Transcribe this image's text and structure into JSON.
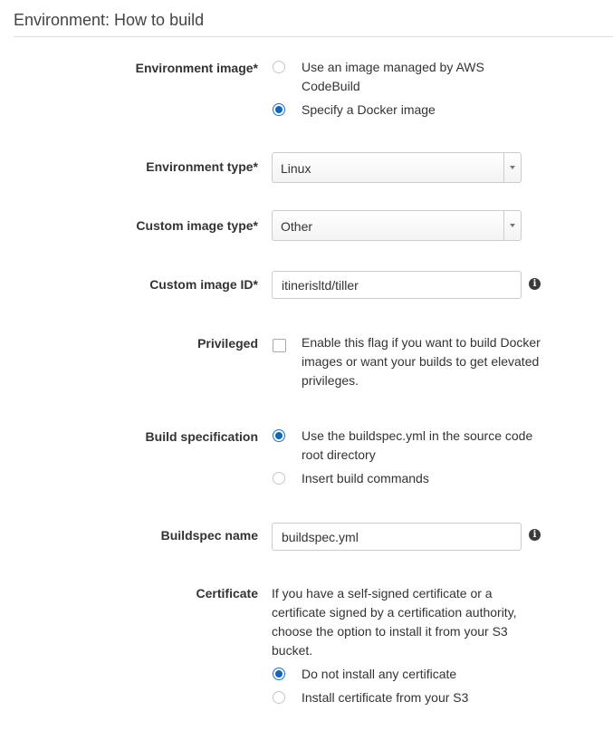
{
  "section": {
    "title": "Environment: How to build"
  },
  "env_image": {
    "label": "Environment image*",
    "options": [
      {
        "label": "Use an image managed by AWS CodeBuild",
        "selected": false
      },
      {
        "label": "Specify a Docker image",
        "selected": true
      }
    ]
  },
  "env_type": {
    "label": "Environment type*",
    "value": "Linux"
  },
  "custom_image_type": {
    "label": "Custom image type*",
    "value": "Other"
  },
  "custom_image_id": {
    "label": "Custom image ID*",
    "value": "itinerisltd/tiller",
    "info_icon": "info-icon"
  },
  "privileged": {
    "label": "Privileged",
    "checked": false,
    "text": "Enable this flag if you want to build Docker images or want your builds to get elevated privileges."
  },
  "build_spec": {
    "label": "Build specification",
    "options": [
      {
        "label": "Use the buildspec.yml in the source code root directory",
        "selected": true
      },
      {
        "label": "Insert build commands",
        "selected": false
      }
    ]
  },
  "buildspec_name": {
    "label": "Buildspec name",
    "value": "buildspec.yml",
    "info_icon": "info-icon"
  },
  "certificate": {
    "label": "Certificate",
    "description": "If you have a self-signed certificate or a certificate signed by a certification authority, choose the option to install it from your S3 bucket.",
    "options": [
      {
        "label": "Do not install any certificate",
        "selected": true
      },
      {
        "label": "Install certificate from your S3",
        "selected": false
      }
    ]
  },
  "colors": {
    "accent": "#1166bb",
    "divider": "#dddddd",
    "text": "#333333"
  }
}
